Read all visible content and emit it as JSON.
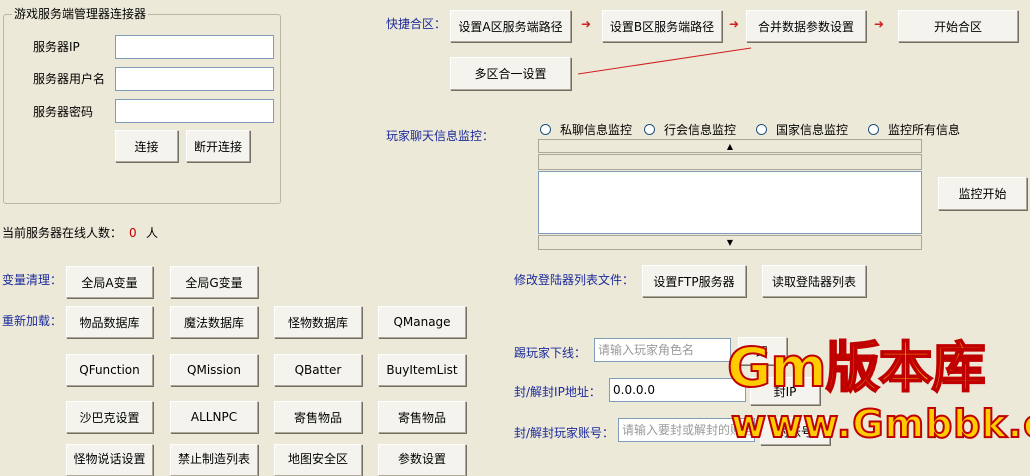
{
  "connector": {
    "group_title": "游戏服务端管理器连接器",
    "ip_label": "服务器IP",
    "user_label": "服务器用户名",
    "password_label": "服务器密码",
    "ip_value": "",
    "user_value": "",
    "password_value": "",
    "connect_button": "连接",
    "disconnect_button": "断开连接"
  },
  "online": {
    "label": "当前服务器在线人数：",
    "count": "0",
    "unit": "人"
  },
  "merge": {
    "label": "快捷合区：",
    "set_a_path": "设置A区服务端路径",
    "set_b_path": "设置B区服务端路径",
    "merge_params": "合并数据参数设置",
    "start_merge": "开始合区",
    "multi_merge": "多区合一设置"
  },
  "chat_monitor": {
    "label": "玩家聊天信息监控：",
    "options": [
      "私聊信息监控",
      "行会信息监控",
      "国家信息监控",
      "监控所有信息"
    ],
    "start_button": "监控开始"
  },
  "variables": {
    "label": "变量清理：",
    "global_a": "全局A变量",
    "global_g": "全局G变量"
  },
  "reload": {
    "label": "重新加载：",
    "buttons": [
      "物品数据库",
      "魔法数据库",
      "怪物数据库",
      "QManage",
      "QFunction",
      "QMission",
      "QBatter",
      "BuyItemList",
      "沙巴克设置",
      "ALLNPC",
      "寄售物品",
      "寄售物品",
      "怪物说话设置",
      "禁止制造列表",
      "地图安全区",
      "参数设置"
    ]
  },
  "login_list": {
    "label": "修改登陆器列表文件：",
    "set_ftp": "设置FTP服务器",
    "read_list": "读取登陆器列表"
  },
  "kick": {
    "label": "踢玩家下线：",
    "placeholder": "请输入玩家角色名",
    "button": "踢"
  },
  "ban_ip": {
    "label": "封/解封IP地址：",
    "value": "0.0.0.0",
    "button": "封IP"
  },
  "ban_account": {
    "label": "封/解封玩家账号：",
    "placeholder": "请输入要封或解封的账号",
    "button": "封账号"
  },
  "watermark": {
    "top": "Gm版本库",
    "bottom": "www.Gmbbk.com"
  },
  "colors": {
    "background": "#ece9d8",
    "label_blue": "#1c2a9b",
    "count_red": "#c00000",
    "arrow_red": "#d02020",
    "watermark_yellow": "#ffcc00"
  }
}
